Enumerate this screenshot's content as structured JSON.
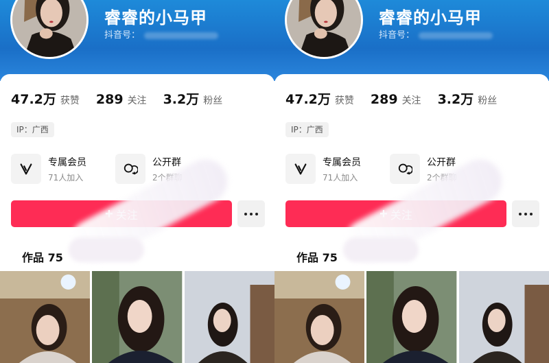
{
  "profile": {
    "name": "睿睿的小马甲",
    "douyin_id_label": "抖音号："
  },
  "stats": [
    {
      "value": "47.2万",
      "label": "获赞"
    },
    {
      "value": "289",
      "label": "关注"
    },
    {
      "value": "3.2万",
      "label": "粉丝"
    }
  ],
  "ip_tag": "IP：广西",
  "features": [
    {
      "icon": "vip-icon",
      "title": "专属会员",
      "subtitle": "71人加入"
    },
    {
      "icon": "group-chat-icon",
      "title": "公开群",
      "subtitle": "2个群聊"
    }
  ],
  "actions": {
    "follow_label": "关注",
    "more_icon": "more-icon"
  },
  "works": {
    "label": "作品 75"
  },
  "colors": {
    "header_blue": "#1a6fc7",
    "follow_red": "#fe2c55"
  }
}
